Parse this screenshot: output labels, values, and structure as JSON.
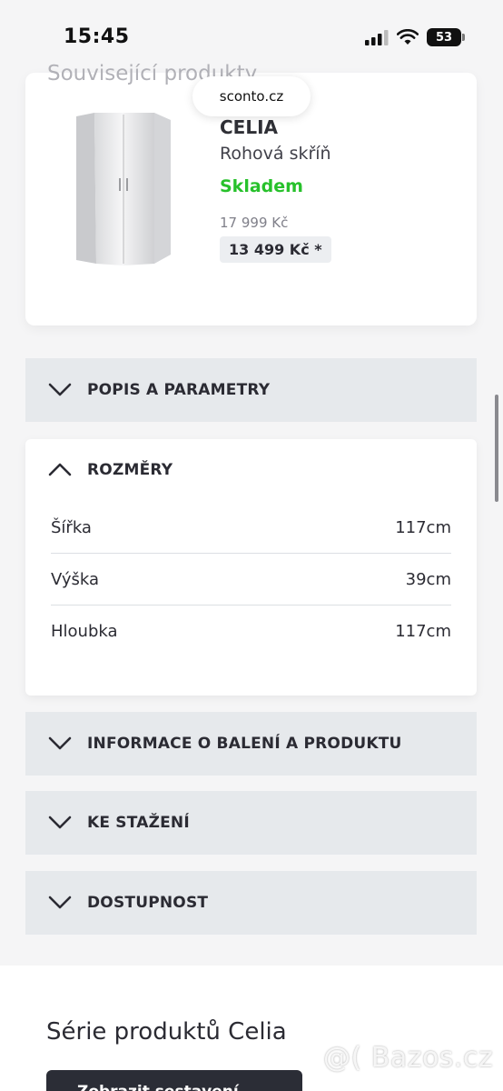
{
  "status_bar": {
    "time": "15:45",
    "battery": "53"
  },
  "browser": {
    "url": "sconto.cz"
  },
  "related": {
    "section_title": "Související produkty",
    "product": {
      "name": "CELIA",
      "type": "Rohová skříň",
      "stock": "Skladem",
      "price_old": "17 999 Kč",
      "price_new": "13 499 Kč *"
    }
  },
  "accordion": {
    "description": "POPIS A PARAMETRY",
    "dimensions": "ROZMĚRY",
    "packaging": "INFORMACE O BALENÍ A PRODUKTU",
    "downloads": "KE STAŽENÍ",
    "availability": "DOSTUPNOST"
  },
  "dimensions": [
    {
      "label": "Šířka",
      "value": "117cm"
    },
    {
      "label": "Výška",
      "value": "39cm"
    },
    {
      "label": "Hloubka",
      "value": "117cm"
    }
  ],
  "series": {
    "title": "Série produktů Celia",
    "button": "Zobrazit sestavení"
  },
  "watermark": "@( Bazos.cz",
  "colors": {
    "in_stock": "#27c12b",
    "accordion_bg": "#e6e9ec",
    "button_bg": "#2b2d36"
  }
}
